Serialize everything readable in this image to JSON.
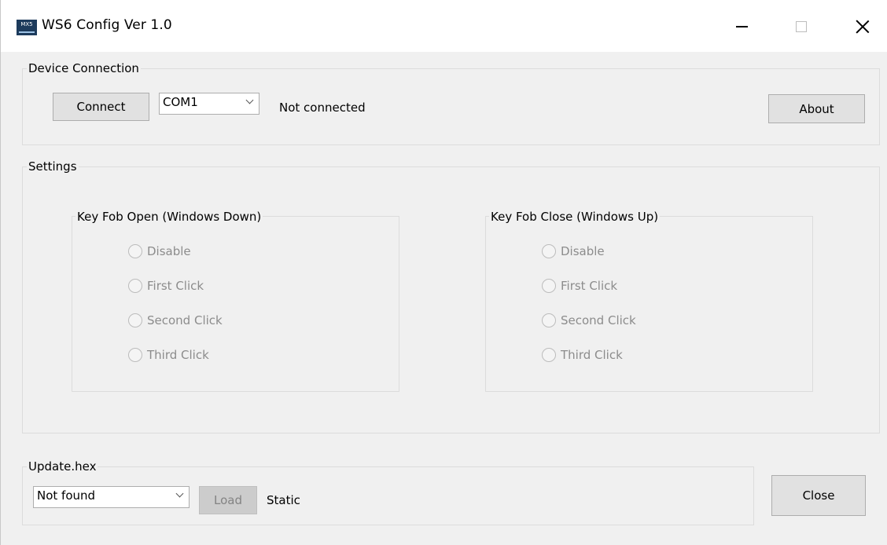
{
  "window": {
    "title": "WS6 Config Ver 1.0",
    "icon_text": "MX5"
  },
  "device_connection": {
    "label": "Device Connection",
    "connect_label": "Connect",
    "port_value": "COM1",
    "status": "Not connected",
    "about_label": "About"
  },
  "settings": {
    "label": "Settings",
    "open_group": {
      "label": "Key Fob Open (Windows Down)",
      "options": [
        "Disable",
        "First Click",
        "Second Click",
        "Third Click"
      ]
    },
    "close_group": {
      "label": "Key Fob Close (Windows Up)",
      "options": [
        "Disable",
        "First Click",
        "Second Click",
        "Third Click"
      ]
    }
  },
  "update": {
    "label": "Update.hex",
    "file_value": "Not found",
    "load_label": "Load",
    "status": "Static",
    "close_label": "Close"
  },
  "colors": {
    "title_bar": "#ffffff",
    "window_bg": "#f0f0f0",
    "button_bg": "#e1e1e1",
    "disabled_text": "#8c8c8c"
  }
}
